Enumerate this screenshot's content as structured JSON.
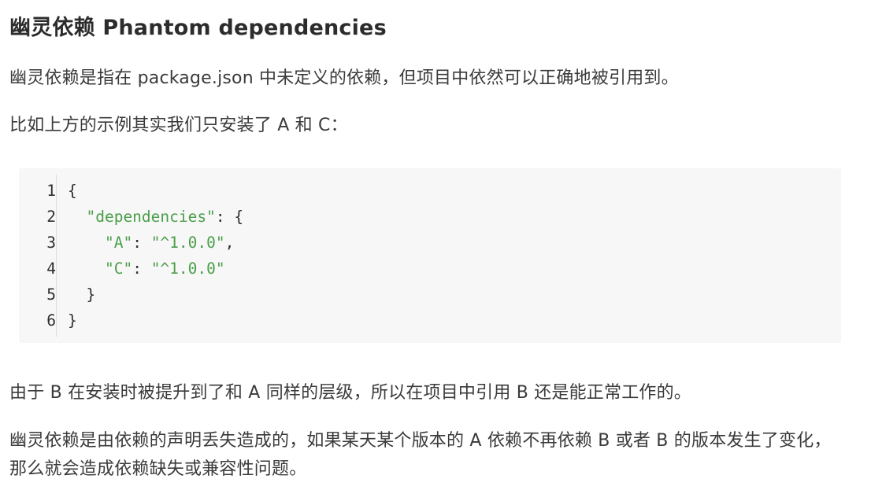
{
  "heading": "幽灵依赖 Phantom dependencies",
  "paragraphs": {
    "p1": "幽灵依赖是指在 package.json 中未定义的依赖，但项目中依然可以正确地被引用到。",
    "p2": "比如上方的示例其实我们只安装了 A 和 C：",
    "p3": "由于 B 在安装时被提升到了和 A 同样的层级，所以在项目中引用 B 还是能正常工作的。",
    "p4": "幽灵依赖是由依赖的声明丢失造成的，如果某天某个版本的 A 依赖不再依赖 B 或者 B 的版本发生了变化，那么就会造成依赖缺失或兼容性问题。"
  },
  "code": {
    "line_numbers": [
      "1",
      "2",
      "3",
      "4",
      "5",
      "6"
    ],
    "line1": "{",
    "line2_indent": "  ",
    "line2_key": "\"dependencies\"",
    "line2_rest": ": {",
    "line3_indent": "    ",
    "line3_key": "\"A\"",
    "line3_sep": ": ",
    "line3_val": "\"^1.0.0\"",
    "line3_end": ",",
    "line4_indent": "    ",
    "line4_key": "\"C\"",
    "line4_sep": ": ",
    "line4_val": "\"^1.0.0\"",
    "line5": "  }",
    "line6": "}"
  },
  "colors": {
    "string": "#4a9e4a",
    "code_background": "#f7f7f7",
    "text": "#3a3a3a"
  }
}
